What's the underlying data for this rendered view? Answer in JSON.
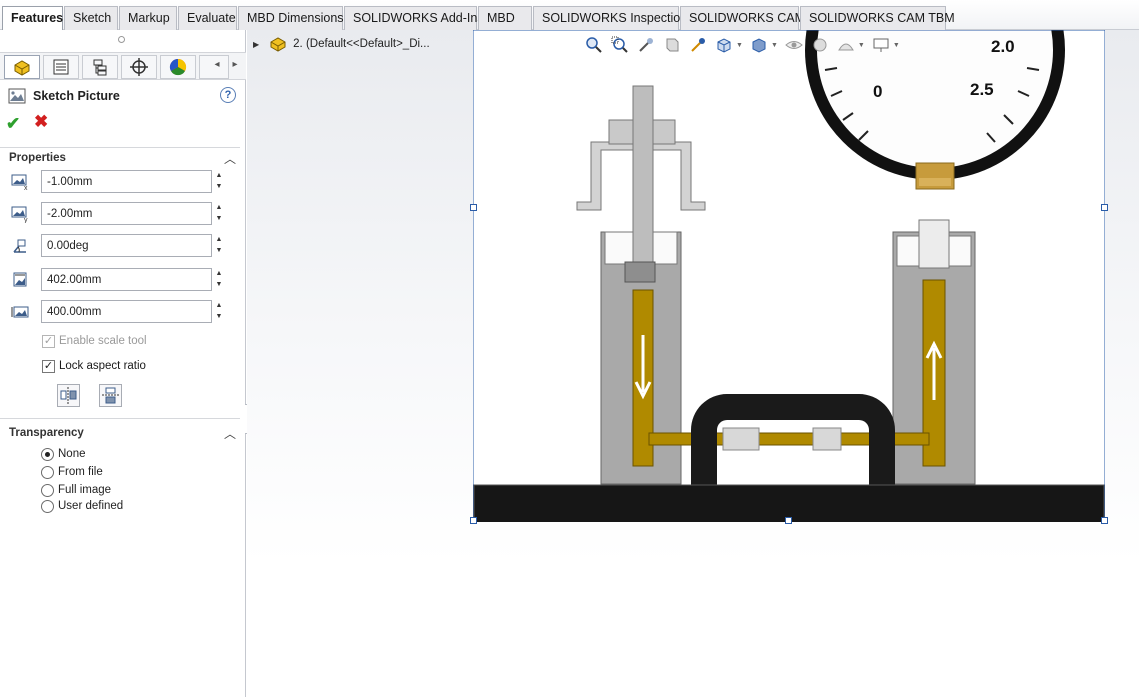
{
  "tabs": [
    {
      "label": "Features",
      "active": true
    },
    {
      "label": "Sketch"
    },
    {
      "label": "Markup"
    },
    {
      "label": "Evaluate"
    },
    {
      "label": "MBD Dimensions"
    },
    {
      "label": "SOLIDWORKS Add-Ins"
    },
    {
      "label": "MBD"
    },
    {
      "label": "SOLIDWORKS Inspection"
    },
    {
      "label": "SOLIDWORKS CAM"
    },
    {
      "label": "SOLIDWORKS CAM TBM"
    }
  ],
  "property_manager": {
    "title": "Sketch Picture",
    "help_glyph": "?",
    "ok_glyph": "✔",
    "cancel_glyph": "✖",
    "properties": {
      "header": "Properties",
      "x_position": "-1.00mm",
      "y_position": "-2.00mm",
      "angle": "0.00deg",
      "width": "402.00mm",
      "height": "400.00mm",
      "enable_scale_tool": "Enable scale tool",
      "enable_scale_tool_checked": true,
      "lock_aspect_ratio": "Lock aspect ratio",
      "lock_aspect_ratio_checked": true
    },
    "transparency": {
      "header": "Transparency",
      "options": [
        "None",
        "From file",
        "Full image",
        "User defined"
      ],
      "selected": "None"
    }
  },
  "feature_tree": {
    "item_label": "2.  (Default<<Default>_Di..."
  },
  "picture": {
    "gauge_labels": [
      "2.0",
      "0",
      "2.5"
    ]
  },
  "colors": {
    "accent": "#2a5ca8",
    "ok": "#2ea02e",
    "cancel": "#d21f1f",
    "brass": "#b08a00"
  }
}
